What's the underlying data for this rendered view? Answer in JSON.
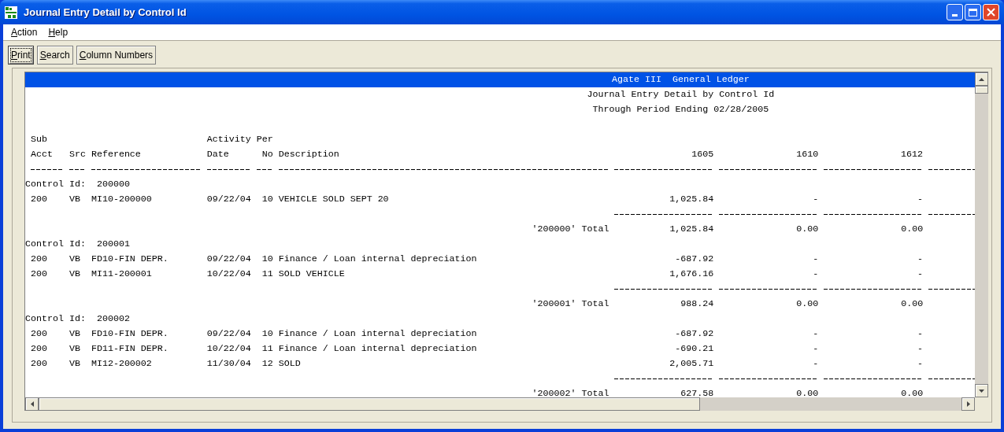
{
  "window": {
    "title": "Journal Entry Detail by Control Id"
  },
  "menu": [
    {
      "label": "Action"
    },
    {
      "label": "Help"
    }
  ],
  "toolbar": [
    {
      "label": "Print",
      "focused": true
    },
    {
      "label": "Search",
      "focused": false
    },
    {
      "label": "Column Numbers",
      "focused": false
    }
  ],
  "report": {
    "banner": "Agate III  General Ledger",
    "subtitles": [
      "Journal Entry Detail by Control Id",
      "Through Period Ending 02/28/2005"
    ],
    "headers": {
      "sub_top": "Sub",
      "acct": "Acct",
      "src": "Src",
      "reference": "Reference",
      "activity_top": "Activity",
      "date": "Date",
      "per_top": "Per",
      "no": "No",
      "description": "Description",
      "amounts": [
        "1605",
        "1610",
        "1612"
      ]
    },
    "groups": [
      {
        "control_label": "Control Id:",
        "control_id": "200000",
        "rows": [
          {
            "acct": "200",
            "src": "VB",
            "reference": "MI10-200000",
            "date": "09/22/04",
            "per": "10",
            "description": "VEHICLE SOLD SEPT 20",
            "amounts": [
              "1,025.84",
              "-",
              "-"
            ]
          }
        ],
        "total_label": "'200000' Total",
        "totals": [
          "1,025.84",
          "0.00",
          "0.00"
        ]
      },
      {
        "control_label": "Control Id:",
        "control_id": "200001",
        "rows": [
          {
            "acct": "200",
            "src": "VB",
            "reference": "FD10-FIN DEPR.",
            "date": "09/22/04",
            "per": "10",
            "description": "Finance / Loan internal depreciation",
            "amounts": [
              "-687.92",
              "-",
              "-"
            ]
          },
          {
            "acct": "200",
            "src": "VB",
            "reference": "MI11-200001",
            "date": "10/22/04",
            "per": "11",
            "description": "SOLD VEHICLE",
            "amounts": [
              "1,676.16",
              "-",
              "-"
            ]
          }
        ],
        "total_label": "'200001' Total",
        "totals": [
          "988.24",
          "0.00",
          "0.00"
        ]
      },
      {
        "control_label": "Control Id:",
        "control_id": "200002",
        "rows": [
          {
            "acct": "200",
            "src": "VB",
            "reference": "FD10-FIN DEPR.",
            "date": "09/22/04",
            "per": "10",
            "description": "Finance / Loan internal depreciation",
            "amounts": [
              "-687.92",
              "-",
              "-"
            ]
          },
          {
            "acct": "200",
            "src": "VB",
            "reference": "FD11-FIN DEPR.",
            "date": "10/22/04",
            "per": "11",
            "description": "Finance / Loan internal depreciation",
            "amounts": [
              "-690.21",
              "-",
              "-"
            ]
          },
          {
            "acct": "200",
            "src": "VB",
            "reference": "MI12-200002",
            "date": "11/30/04",
            "per": "12",
            "description": "SOLD",
            "amounts": [
              "2,005.71",
              "-",
              "-"
            ]
          }
        ],
        "total_label": "'200002' Total",
        "totals": [
          "627.58",
          "0.00",
          "0.00"
        ]
      }
    ]
  }
}
